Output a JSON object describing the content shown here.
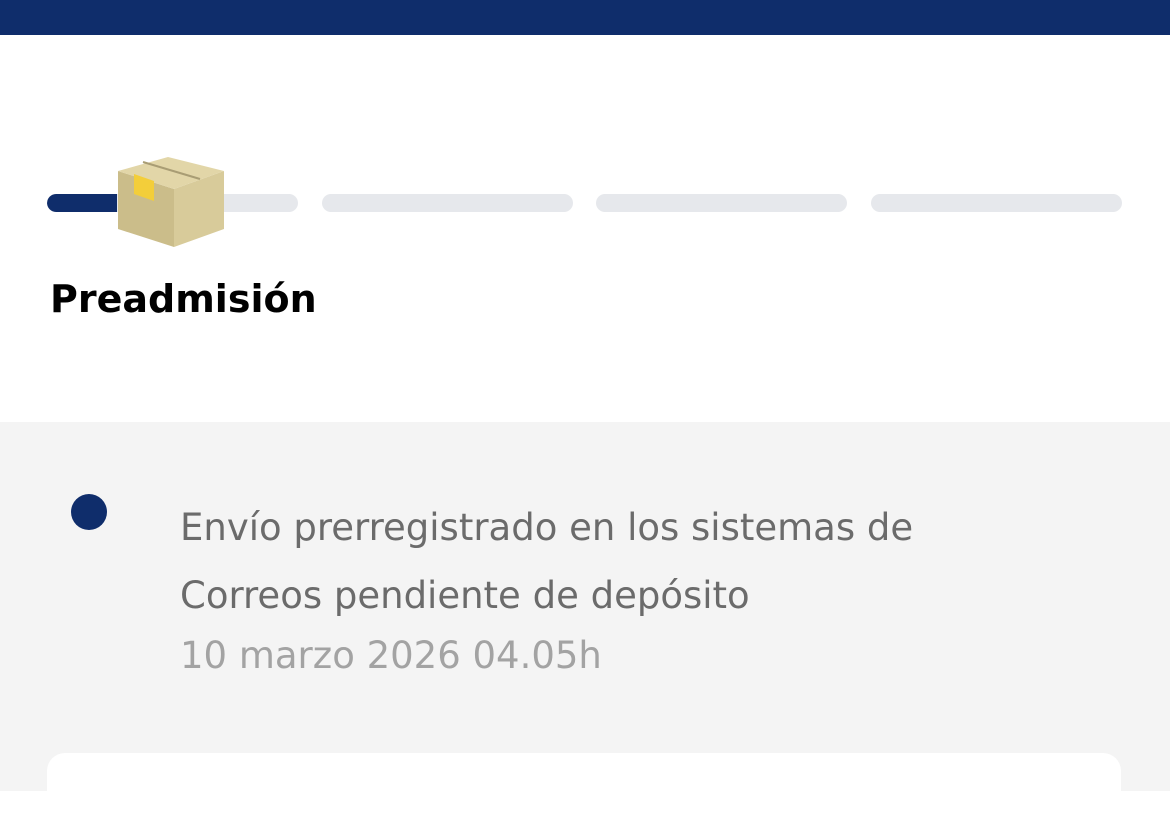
{
  "colors": {
    "brand": "#0f2d6b",
    "track_inactive": "#e6e8ec",
    "event_text": "#6b6b6b",
    "event_date": "#a3a3a3",
    "events_background": "#f4f4f4"
  },
  "tracker": {
    "steps": [
      {
        "progress": 0.28,
        "active": true
      },
      {
        "progress": 0,
        "active": false
      },
      {
        "progress": 0,
        "active": false
      },
      {
        "progress": 0,
        "active": false
      }
    ],
    "current_step_icon": "package-box-icon",
    "current_step_label": "Preadmisión"
  },
  "events": [
    {
      "description": "Envío prerregistrado en los sistemas de Correos pendiente de depósito",
      "date": "10 marzo 2026 04.05h"
    }
  ]
}
